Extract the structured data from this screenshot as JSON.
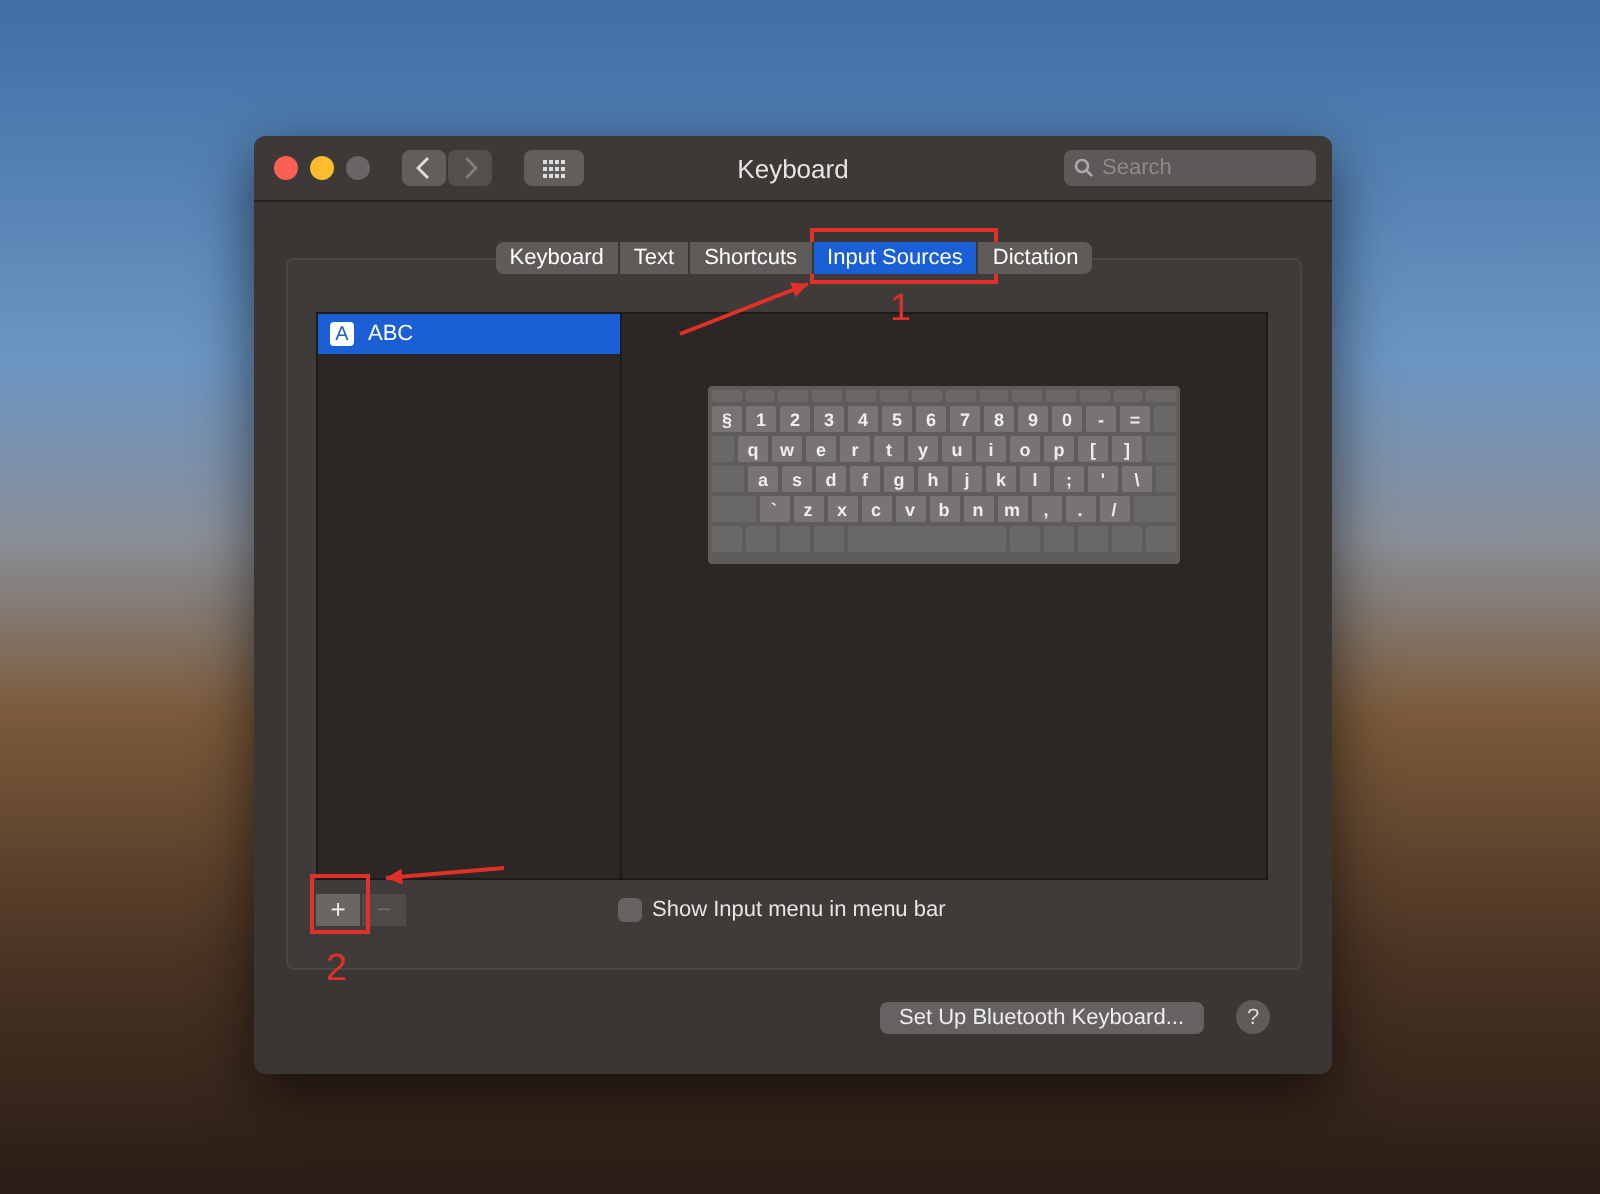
{
  "window": {
    "title": "Keyboard",
    "search": {
      "placeholder": "Search"
    }
  },
  "tabs": [
    {
      "label": "Keyboard",
      "selected": false
    },
    {
      "label": "Text",
      "selected": false
    },
    {
      "label": "Shortcuts",
      "selected": false
    },
    {
      "label": "Input Sources",
      "selected": true
    },
    {
      "label": "Dictation",
      "selected": false
    }
  ],
  "sources": [
    {
      "icon_letter": "A",
      "name": "ABC",
      "selected": true
    }
  ],
  "keyboard": {
    "key_rows": [
      {
        "keys": [
          "§",
          "1",
          "2",
          "3",
          "4",
          "5",
          "6",
          "7",
          "8",
          "9",
          "0",
          "-",
          "="
        ]
      },
      {
        "keys": [
          "q",
          "w",
          "e",
          "r",
          "t",
          "y",
          "u",
          "i",
          "o",
          "p",
          "[",
          "]"
        ]
      },
      {
        "keys": [
          "a",
          "s",
          "d",
          "f",
          "g",
          "h",
          "j",
          "k",
          "l",
          ";",
          "'",
          "\\"
        ]
      },
      {
        "keys": [
          "`",
          "z",
          "x",
          "c",
          "v",
          "b",
          "n",
          "m",
          ",",
          ".",
          "/"
        ]
      }
    ]
  },
  "list_buttons": [
    {
      "label": "+",
      "disabled": false
    },
    {
      "label": "−",
      "disabled": true
    }
  ],
  "show_input_menu": {
    "label": "Show Input menu in menu bar",
    "checked": false
  },
  "footer": {
    "button": "Set Up Bluetooth Keyboard...",
    "help": "?"
  },
  "annotations": [
    {
      "label": "1"
    },
    {
      "label": "2"
    }
  ]
}
